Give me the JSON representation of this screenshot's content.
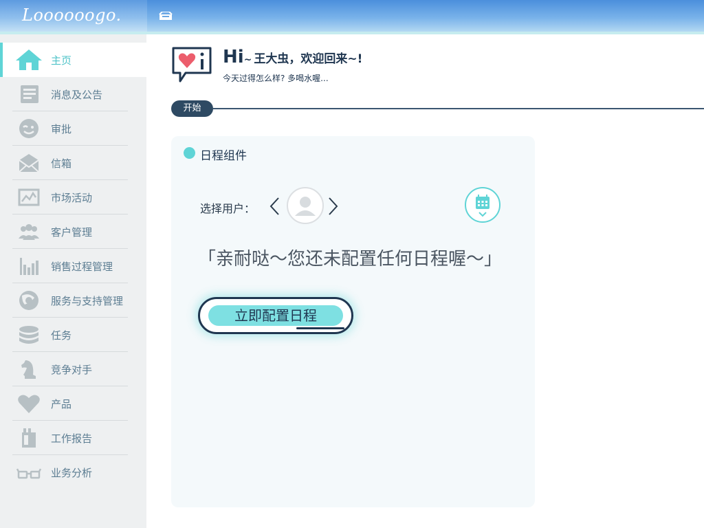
{
  "app": {
    "logo": "Loooooogo."
  },
  "sidebar": {
    "items": [
      {
        "label": "主页",
        "icon": "home-icon",
        "active": true
      },
      {
        "label": "消息及公告",
        "icon": "news-icon"
      },
      {
        "label": "审批",
        "icon": "approval-icon"
      },
      {
        "label": "信箱",
        "icon": "mail-icon"
      },
      {
        "label": "市场活动",
        "icon": "market-chart-icon"
      },
      {
        "label": "客户管理",
        "icon": "customers-icon"
      },
      {
        "label": "销售过程管理",
        "icon": "bar-chart-icon"
      },
      {
        "label": "服务与支持管理",
        "icon": "service-globe-icon"
      },
      {
        "label": "任务",
        "icon": "task-stack-icon"
      },
      {
        "label": "竞争对手",
        "icon": "chess-knight-icon"
      },
      {
        "label": "产品",
        "icon": "heart-icon"
      },
      {
        "label": "工作报告",
        "icon": "report-icon"
      },
      {
        "label": "业务分析",
        "icon": "glasses-icon"
      }
    ]
  },
  "greeting": {
    "hi": "Hi",
    "tilde": "~",
    "message": "王大虫，欢迎回来~!",
    "subtitle": "今天过得怎么样? 多喝水喔..."
  },
  "section": {
    "start_label": "开始"
  },
  "schedule_widget": {
    "title": "日程组件",
    "select_user_label": "选择用户：",
    "empty_message": "「亲耐哒～您还未配置任何日程喔～」",
    "configure_button": "立即配置日程"
  },
  "colors": {
    "accent": "#5fd4d6",
    "navy": "#1f3650",
    "sidebar_bg": "#eef0f1"
  }
}
